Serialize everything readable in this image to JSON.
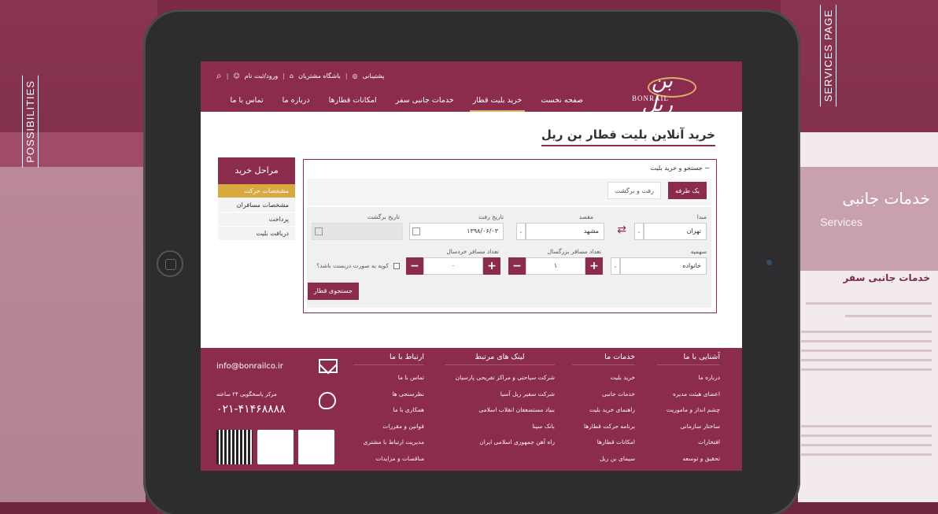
{
  "background": {
    "left_label": "POSSIBILITIES",
    "right_label": "SERVICES PAGE",
    "right_title": "خدمات جانبی",
    "right_subtitle": "Services",
    "right_heading": "خدمات جانبی سفر"
  },
  "header": {
    "logo_fa": "بن ریل",
    "logo_en": "BONRAIL",
    "top_links": {
      "support": "پشتیبانی",
      "club": "باشگاه مشتریان",
      "login": "ورود/ثبت نام"
    },
    "nav": [
      {
        "label": "صفحه نخست"
      },
      {
        "label": "خرید بلیت قطار"
      },
      {
        "label": "خدمات جانبی سفر"
      },
      {
        "label": "امکانات قطارها"
      },
      {
        "label": "درباره ما"
      },
      {
        "label": "تماس با ما"
      }
    ]
  },
  "page_title": "خرید آنلاین بلیت قطار بن ریل",
  "steps": {
    "title": "مراحل خرید",
    "items": [
      "مشخصات حرکت",
      "مشخصات مسافران",
      "پرداخت",
      "دریافت بلیت"
    ]
  },
  "search": {
    "heading": "− جستجو و خرید بلیت",
    "one_way": "یک طرفه",
    "round_trip": "رفت و برگشت",
    "origin_label": "مبدا",
    "origin_value": "تهران",
    "dest_label": "مقصد",
    "dest_value": "مشهد",
    "depart_label": "تاریخ رفت",
    "depart_value": "۱۳۹۸/۰۶/۰۳",
    "return_label": "تاریخ برگشت",
    "quota_label": "سهمیه",
    "quota_value": "خانواده",
    "adults_label": "تعداد مسافر بزرگسال",
    "adults_value": "۱",
    "children_label": "تعداد مسافر خردسال",
    "children_value": "۰",
    "coupe_label": "کوپه به صورت دربست باشد؟",
    "submit": "جستجوی قطار"
  },
  "footer": {
    "about": {
      "title": "آشنایی با ما",
      "links": [
        "درباره ما",
        "اعضای هیئت مدیره",
        "چشم انداز و ماموریت",
        "ساختار سازمانی",
        "افتخارات",
        "تحقیق و توسعه"
      ]
    },
    "services": {
      "title": "خدمات ما",
      "links": [
        "خرید بلیت",
        "خدمات جانبی",
        "راهنمای خرید بلیت",
        "برنامه حرکت قطارها",
        "امکانات قطارها",
        "سیمای بن ریل"
      ]
    },
    "related": {
      "title": "لینک های مرتبط",
      "links": [
        "شرکت سیاحتی و مراکز تفریحی پارسیان",
        "شرکت سفیر ریل آسیا",
        "بنیاد مستضعفان انقلاب اسلامی",
        "بانک سینا",
        "راه آهن جمهوری اسلامی ایران"
      ]
    },
    "contact_links": {
      "title": "ارتباط با ما",
      "links": [
        "تماس با ما",
        "نظرسنجی ها",
        "همکاری با ما",
        "قوانین و مقررات",
        "مدیریت ارتباط با مشتری",
        "مناقصات و مزایدات"
      ]
    },
    "email": "info@bonrailco.ir",
    "phone_label": "مرکز پاسخگویی ۲۴ ساعته",
    "phone": "۰۲۱-۴۱۴۶۸۸۸۸"
  }
}
